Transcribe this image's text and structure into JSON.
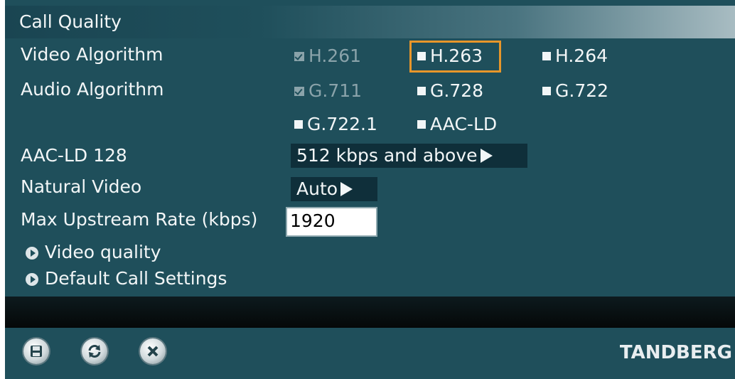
{
  "panel": {
    "title": "Call Quality"
  },
  "video_algorithm": {
    "label": "Video Algorithm",
    "options": [
      {
        "label": "H.261",
        "checked": true,
        "disabled": true
      },
      {
        "label": "H.263",
        "checked": false,
        "focused": true
      },
      {
        "label": "H.264",
        "checked": false
      }
    ]
  },
  "audio_algorithm": {
    "label": "Audio Algorithm",
    "options": [
      {
        "label": "G.711",
        "checked": true,
        "disabled": true
      },
      {
        "label": "G.728",
        "checked": false
      },
      {
        "label": "G.722",
        "checked": false
      },
      {
        "label": "G.722.1",
        "checked": false
      },
      {
        "label": "AAC-LD",
        "checked": false
      }
    ]
  },
  "aac_ld_128": {
    "label": "AAC-LD 128",
    "value": "512 kbps and above"
  },
  "natural_video": {
    "label": "Natural Video",
    "value": "Auto"
  },
  "max_upstream": {
    "label": "Max Upstream Rate (kbps)",
    "value": "1920"
  },
  "links": {
    "video_quality": "Video quality",
    "default_call_settings": "Default Call Settings"
  },
  "toolbar": {
    "save_icon": "save-icon",
    "refresh_icon": "refresh-icon",
    "close_icon": "close-icon"
  },
  "brand": {
    "logo": "TANDBERG"
  },
  "colors": {
    "panel_bg": "#1f4f5b",
    "focus": "#e8962a",
    "dropdown_bg": "#0f2f3a"
  }
}
